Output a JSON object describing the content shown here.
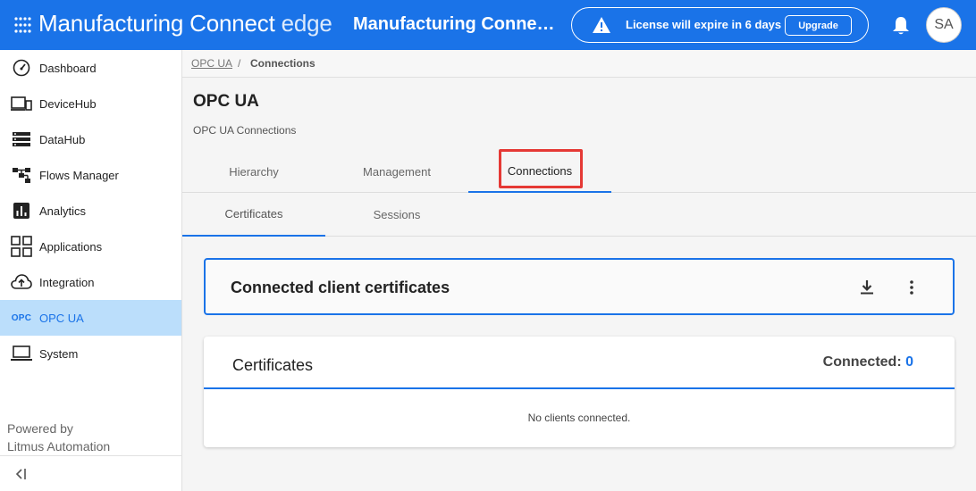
{
  "header": {
    "brand_main": "Manufacturing Connect",
    "brand_suffix": "edge",
    "page_name": "Manufacturing Connect edge",
    "license_text": "License will expire in 6 days",
    "upgrade_label": "Upgrade",
    "avatar_initials": "SA"
  },
  "sidebar": {
    "items": [
      {
        "label": "Dashboard",
        "icon": "dashboard-gauge-icon"
      },
      {
        "label": "DeviceHub",
        "icon": "devices-icon"
      },
      {
        "label": "DataHub",
        "icon": "storage-icon"
      },
      {
        "label": "Flows Manager",
        "icon": "flow-icon"
      },
      {
        "label": "Analytics",
        "icon": "analytics-icon"
      },
      {
        "label": "Applications",
        "icon": "apps-grid-icon"
      },
      {
        "label": "Integration",
        "icon": "cloud-upload-icon"
      },
      {
        "label": "OPC UA",
        "icon": "opc-icon",
        "glyph": "OPC"
      },
      {
        "label": "System",
        "icon": "laptop-icon"
      }
    ],
    "active_index": 7,
    "powered_by_line1": "Powered by",
    "powered_by_line2": "Litmus Automation"
  },
  "breadcrumb": {
    "parent": "OPC UA",
    "separator": "/",
    "current": "Connections"
  },
  "page": {
    "title": "OPC UA",
    "subtitle": "OPC UA Connections"
  },
  "tabs": [
    {
      "label": "Hierarchy"
    },
    {
      "label": "Management"
    },
    {
      "label": "Connections"
    }
  ],
  "active_tab": 2,
  "subtabs": [
    {
      "label": "Certificates"
    },
    {
      "label": "Sessions"
    }
  ],
  "active_subtab": 0,
  "connected_card": {
    "title": "Connected client certificates"
  },
  "certificates_card": {
    "title": "Certificates",
    "connected_label": "Connected:",
    "connected_count": "0",
    "empty_message": "No clients connected."
  },
  "colors": {
    "primary": "#1a73e8",
    "active_nav_bg": "#bbdefb",
    "highlight": "#e53935"
  }
}
